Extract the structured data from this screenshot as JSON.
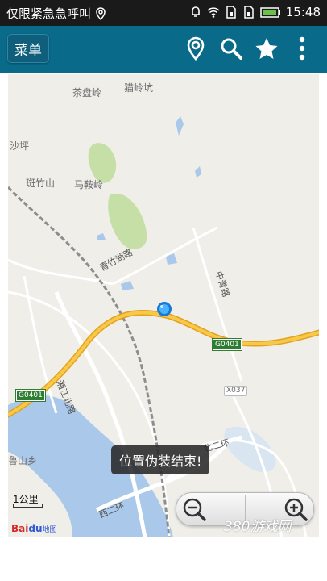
{
  "status_bar": {
    "emergency_text": "仅限紧急急呼叫",
    "time": "15:48",
    "icons": [
      "location-pin-icon",
      "alarm-icon",
      "wifi-icon",
      "sim1-icon",
      "sim2-icon",
      "battery-icon"
    ]
  },
  "app_bar": {
    "menu_label": "菜单",
    "icons": [
      "location-pin-icon",
      "search-icon",
      "star-icon",
      "overflow-menu-icon"
    ],
    "color": "#0a6a8a"
  },
  "map": {
    "place_labels": [
      "茶盘岭",
      "猫岭坑",
      "沙坪",
      "斑竹山",
      "马鞍岭",
      "鲁山乡"
    ],
    "road_labels": [
      "青竹湖路",
      "中青路",
      "湘江北路",
      "北二环",
      "西二环"
    ],
    "highway_shields": [
      "G0401",
      "G0401"
    ],
    "small_shield": "X037",
    "toast": "位置伪装结束!",
    "scale": "1公里",
    "logo": {
      "brand": "Bai",
      "paw": "du",
      "suffix": "地图"
    },
    "watermark": "380游戏网"
  }
}
